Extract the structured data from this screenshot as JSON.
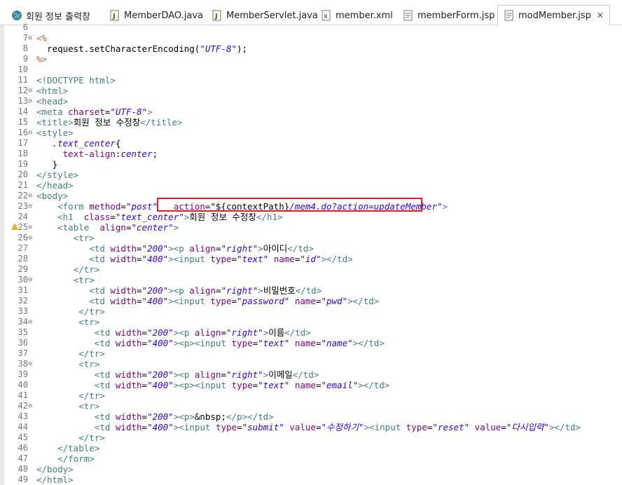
{
  "tabs": [
    {
      "label": "회원 정보 출력창",
      "icon": "globe-icon"
    },
    {
      "label": "MemberDAO.java",
      "icon": "java-file-icon"
    },
    {
      "label": "MemberServlet.java",
      "icon": "java-file-icon"
    },
    {
      "label": "member.xml",
      "icon": "xml-file-icon"
    },
    {
      "label": "memberForm.jsp",
      "icon": "jsp-file-icon"
    },
    {
      "label": "modMember.jsp",
      "icon": "jsp-file-icon",
      "close": "✕"
    }
  ],
  "lines": [
    {
      "n": "6",
      "fold": "",
      "segs": []
    },
    {
      "n": "7",
      "fold": "⊖",
      "segs": [
        [
          "jsp",
          "<%"
        ]
      ]
    },
    {
      "n": "8",
      "fold": "",
      "segs": [
        [
          "txt",
          "  request.setCharacterEncoding("
        ],
        [
          "val",
          "\"UTF-8\""
        ],
        [
          "txt",
          ");"
        ]
      ]
    },
    {
      "n": "9",
      "fold": "",
      "segs": [
        [
          "jsp",
          "%>"
        ]
      ]
    },
    {
      "n": "10",
      "fold": "",
      "segs": []
    },
    {
      "n": "11",
      "fold": "",
      "segs": [
        [
          "tag",
          "<!DOCTYPE html>"
        ]
      ]
    },
    {
      "n": "12",
      "fold": "⊖",
      "segs": [
        [
          "tag",
          "<html>"
        ]
      ]
    },
    {
      "n": "13",
      "fold": "⊖",
      "segs": [
        [
          "tag",
          "<head>"
        ]
      ]
    },
    {
      "n": "14",
      "fold": "",
      "segs": [
        [
          "tag",
          "<meta "
        ],
        [
          "attr",
          "charset"
        ],
        [
          "txt",
          "="
        ],
        [
          "val",
          "\"UTF-8\""
        ],
        [
          "tag",
          ">"
        ]
      ]
    },
    {
      "n": "15",
      "fold": "",
      "segs": [
        [
          "tag",
          "<title>"
        ],
        [
          "txt",
          "회원 정보 수정창"
        ],
        [
          "tag",
          "</title>"
        ]
      ]
    },
    {
      "n": "16",
      "fold": "⊖",
      "segs": [
        [
          "tag",
          "<style>"
        ]
      ]
    },
    {
      "n": "17",
      "fold": "",
      "segs": [
        [
          "txt",
          "   "
        ],
        [
          "cssval",
          ".text_center"
        ],
        [
          "txt",
          "{"
        ]
      ]
    },
    {
      "n": "18",
      "fold": "",
      "segs": [
        [
          "txt",
          "     "
        ],
        [
          "cssprop",
          "text-align"
        ],
        [
          "txt",
          ":"
        ],
        [
          "cssval",
          "center"
        ],
        [
          "txt",
          ";"
        ]
      ]
    },
    {
      "n": "19",
      "fold": "",
      "segs": [
        [
          "txt",
          "   }"
        ]
      ]
    },
    {
      "n": "20",
      "fold": "",
      "segs": [
        [
          "tag",
          "</style>"
        ]
      ]
    },
    {
      "n": "21",
      "fold": "",
      "segs": [
        [
          "tag",
          "</head>"
        ]
      ]
    },
    {
      "n": "22",
      "fold": "⊖",
      "segs": [
        [
          "tag",
          "<body>"
        ]
      ]
    },
    {
      "n": "23",
      "fold": "⊖",
      "segs": [
        [
          "txt",
          "    "
        ],
        [
          "tag",
          "<form "
        ],
        [
          "attr",
          "method"
        ],
        [
          "txt",
          "="
        ],
        [
          "val",
          "\"post\""
        ],
        [
          "txt",
          "   "
        ],
        [
          "attr",
          "action"
        ],
        [
          "txt",
          "=\"${contextPath}"
        ],
        [
          "val",
          "/mem4.do?action=updateMember\""
        ],
        [
          "tag",
          ">"
        ]
      ]
    },
    {
      "n": "24",
      "fold": "",
      "segs": [
        [
          "txt",
          "    "
        ],
        [
          "tag",
          "<h1  "
        ],
        [
          "attr",
          "class"
        ],
        [
          "txt",
          "="
        ],
        [
          "val",
          "\"text_center\""
        ],
        [
          "tag",
          ">"
        ],
        [
          "txt",
          "회원 정보 수정창"
        ],
        [
          "tag",
          "</h1>"
        ]
      ]
    },
    {
      "n": "25",
      "fold": "⊖",
      "warn": true,
      "segs": [
        [
          "txt",
          "    "
        ],
        [
          "tag",
          "<table  "
        ],
        [
          "attr",
          "align"
        ],
        [
          "txt",
          "="
        ],
        [
          "val",
          "\"center\""
        ],
        [
          "tag",
          ">"
        ]
      ]
    },
    {
      "n": "26",
      "fold": "⊖",
      "segs": [
        [
          "txt",
          "       "
        ],
        [
          "tag",
          "<tr>"
        ]
      ]
    },
    {
      "n": "27",
      "fold": "",
      "segs": [
        [
          "txt",
          "          "
        ],
        [
          "tag",
          "<td "
        ],
        [
          "attr",
          "width"
        ],
        [
          "txt",
          "="
        ],
        [
          "val",
          "\"200\""
        ],
        [
          "tag",
          "><p "
        ],
        [
          "attr",
          "align"
        ],
        [
          "txt",
          "="
        ],
        [
          "val",
          "\"right\""
        ],
        [
          "tag",
          ">"
        ],
        [
          "txt",
          "아이디"
        ],
        [
          "tag",
          "</td>"
        ]
      ]
    },
    {
      "n": "28",
      "fold": "",
      "segs": [
        [
          "txt",
          "          "
        ],
        [
          "tag",
          "<td "
        ],
        [
          "attr",
          "width"
        ],
        [
          "txt",
          "="
        ],
        [
          "val",
          "\"400\""
        ],
        [
          "tag",
          "><input "
        ],
        [
          "attr",
          "type"
        ],
        [
          "txt",
          "="
        ],
        [
          "val",
          "\"text\""
        ],
        [
          "txt",
          " "
        ],
        [
          "attr",
          "name"
        ],
        [
          "txt",
          "="
        ],
        [
          "val",
          "\"id\""
        ],
        [
          "tag",
          "></td>"
        ]
      ]
    },
    {
      "n": "29",
      "fold": "",
      "segs": [
        [
          "txt",
          "       "
        ],
        [
          "tag",
          "</tr>"
        ]
      ]
    },
    {
      "n": "30",
      "fold": "⊖",
      "segs": [
        [
          "txt",
          "       "
        ],
        [
          "tag",
          "<tr>"
        ]
      ]
    },
    {
      "n": "31",
      "fold": "",
      "segs": [
        [
          "txt",
          "          "
        ],
        [
          "tag",
          "<td "
        ],
        [
          "attr",
          "width"
        ],
        [
          "txt",
          "="
        ],
        [
          "val",
          "\"200\""
        ],
        [
          "tag",
          "><p "
        ],
        [
          "attr",
          "align"
        ],
        [
          "txt",
          "="
        ],
        [
          "val",
          "\"right\""
        ],
        [
          "tag",
          ">"
        ],
        [
          "txt",
          "비밀번호"
        ],
        [
          "tag",
          "</td>"
        ]
      ]
    },
    {
      "n": "32",
      "fold": "",
      "segs": [
        [
          "txt",
          "          "
        ],
        [
          "tag",
          "<td "
        ],
        [
          "attr",
          "width"
        ],
        [
          "txt",
          "="
        ],
        [
          "val",
          "\"400\""
        ],
        [
          "tag",
          "><input "
        ],
        [
          "attr",
          "type"
        ],
        [
          "txt",
          "="
        ],
        [
          "val",
          "\"password\""
        ],
        [
          "txt",
          " "
        ],
        [
          "attr",
          "name"
        ],
        [
          "txt",
          "="
        ],
        [
          "val",
          "\"pwd\""
        ],
        [
          "tag",
          "></td>"
        ]
      ]
    },
    {
      "n": "33",
      "fold": "",
      "segs": [
        [
          "txt",
          "        "
        ],
        [
          "tag",
          "</tr>"
        ]
      ]
    },
    {
      "n": "34",
      "fold": "⊖",
      "segs": [
        [
          "txt",
          "        "
        ],
        [
          "tag",
          "<tr>"
        ]
      ]
    },
    {
      "n": "35",
      "fold": "",
      "segs": [
        [
          "txt",
          "           "
        ],
        [
          "tag",
          "<td "
        ],
        [
          "attr",
          "width"
        ],
        [
          "txt",
          "="
        ],
        [
          "val",
          "\"200\""
        ],
        [
          "tag",
          "><p "
        ],
        [
          "attr",
          "align"
        ],
        [
          "txt",
          "="
        ],
        [
          "val",
          "\"right\""
        ],
        [
          "tag",
          ">"
        ],
        [
          "txt",
          "이름"
        ],
        [
          "tag",
          "</td>"
        ]
      ]
    },
    {
      "n": "36",
      "fold": "",
      "segs": [
        [
          "txt",
          "           "
        ],
        [
          "tag",
          "<td "
        ],
        [
          "attr",
          "width"
        ],
        [
          "txt",
          "="
        ],
        [
          "val",
          "\"400\""
        ],
        [
          "tag",
          "><p><input "
        ],
        [
          "attr",
          "type"
        ],
        [
          "txt",
          "="
        ],
        [
          "val",
          "\"text\""
        ],
        [
          "txt",
          " "
        ],
        [
          "attr",
          "name"
        ],
        [
          "txt",
          "="
        ],
        [
          "val",
          "\"name\""
        ],
        [
          "tag",
          "></td>"
        ]
      ]
    },
    {
      "n": "37",
      "fold": "",
      "segs": [
        [
          "txt",
          "        "
        ],
        [
          "tag",
          "</tr>"
        ]
      ]
    },
    {
      "n": "38",
      "fold": "⊖",
      "segs": [
        [
          "txt",
          "        "
        ],
        [
          "tag",
          "<tr>"
        ]
      ]
    },
    {
      "n": "39",
      "fold": "",
      "segs": [
        [
          "txt",
          "           "
        ],
        [
          "tag",
          "<td "
        ],
        [
          "attr",
          "width"
        ],
        [
          "txt",
          "="
        ],
        [
          "val",
          "\"200\""
        ],
        [
          "tag",
          "><p "
        ],
        [
          "attr",
          "align"
        ],
        [
          "txt",
          "="
        ],
        [
          "val",
          "\"right\""
        ],
        [
          "tag",
          ">"
        ],
        [
          "txt",
          "이메일"
        ],
        [
          "tag",
          "</td>"
        ]
      ]
    },
    {
      "n": "40",
      "fold": "",
      "segs": [
        [
          "txt",
          "           "
        ],
        [
          "tag",
          "<td "
        ],
        [
          "attr",
          "width"
        ],
        [
          "txt",
          "="
        ],
        [
          "val",
          "\"400\""
        ],
        [
          "tag",
          "><p><input "
        ],
        [
          "attr",
          "type"
        ],
        [
          "txt",
          "="
        ],
        [
          "val",
          "\"text\""
        ],
        [
          "txt",
          " "
        ],
        [
          "attr",
          "name"
        ],
        [
          "txt",
          "="
        ],
        [
          "val",
          "\"email\""
        ],
        [
          "tag",
          "></td>"
        ]
      ]
    },
    {
      "n": "41",
      "fold": "",
      "segs": [
        [
          "txt",
          "        "
        ],
        [
          "tag",
          "</tr>"
        ]
      ]
    },
    {
      "n": "42",
      "fold": "⊖",
      "segs": [
        [
          "txt",
          "        "
        ],
        [
          "tag",
          "<tr>"
        ]
      ]
    },
    {
      "n": "43",
      "fold": "",
      "segs": [
        [
          "txt",
          "           "
        ],
        [
          "tag",
          "<td "
        ],
        [
          "attr",
          "width"
        ],
        [
          "txt",
          "="
        ],
        [
          "val",
          "\"200\""
        ],
        [
          "tag",
          "><p>"
        ],
        [
          "txt",
          "&nbsp;"
        ],
        [
          "tag",
          "</p></td>"
        ]
      ]
    },
    {
      "n": "44",
      "fold": "",
      "segs": [
        [
          "txt",
          "           "
        ],
        [
          "tag",
          "<td "
        ],
        [
          "attr",
          "width"
        ],
        [
          "txt",
          "="
        ],
        [
          "val",
          "\"400\""
        ],
        [
          "tag",
          "><input "
        ],
        [
          "attr",
          "type"
        ],
        [
          "txt",
          "="
        ],
        [
          "val",
          "\"submit\""
        ],
        [
          "txt",
          " "
        ],
        [
          "attr",
          "value"
        ],
        [
          "txt",
          "="
        ],
        [
          "val",
          "\"수정하기\""
        ],
        [
          "tag",
          "><input "
        ],
        [
          "attr",
          "type"
        ],
        [
          "txt",
          "="
        ],
        [
          "val",
          "\"reset\""
        ],
        [
          "txt",
          " "
        ],
        [
          "attr",
          "value"
        ],
        [
          "txt",
          "="
        ],
        [
          "val",
          "\"다시입력\""
        ],
        [
          "tag",
          "></td>"
        ]
      ]
    },
    {
      "n": "45",
      "fold": "",
      "segs": [
        [
          "txt",
          "        "
        ],
        [
          "tag",
          "</tr>"
        ]
      ]
    },
    {
      "n": "46",
      "fold": "",
      "segs": [
        [
          "txt",
          "    "
        ],
        [
          "tag",
          "</table>"
        ]
      ]
    },
    {
      "n": "47",
      "fold": "",
      "segs": [
        [
          "txt",
          "    "
        ],
        [
          "tag",
          "</form>"
        ]
      ]
    },
    {
      "n": "48",
      "fold": "",
      "segs": [
        [
          "tag",
          "</body>"
        ]
      ]
    },
    {
      "n": "49",
      "fold": "",
      "segs": [
        [
          "tag",
          "</html>"
        ]
      ]
    }
  ]
}
